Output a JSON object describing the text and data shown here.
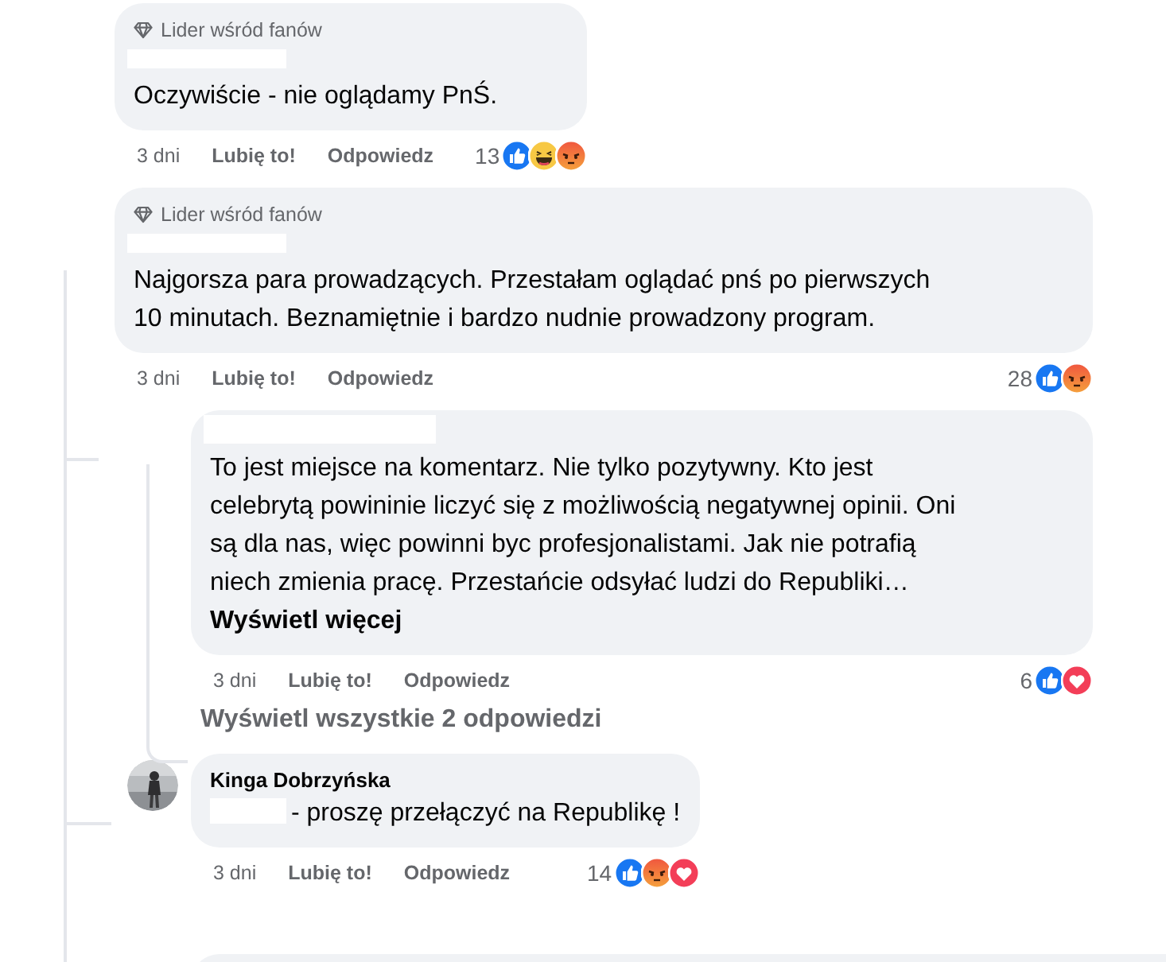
{
  "comments": [
    {
      "kind": "top",
      "badge": "Lider wśród fanów",
      "name_redacted": true,
      "text": "Oczywiście - nie oglądamy PnŚ.",
      "time": "3 dni",
      "like": "Lubię to!",
      "reply": "Odpowiedz",
      "count": "13",
      "reactions": [
        {
          "kind": "like"
        },
        {
          "kind": "haha"
        },
        {
          "kind": "angry"
        }
      ]
    },
    {
      "kind": "top",
      "badge": "Lider wśród fanów",
      "name_redacted": true,
      "text": "Najgorsza para prowadzących. Przestałam oglądać pnś po pierwszych 10 minutach. Beznamiętnie i bardzo nudnie prowadzony program.",
      "time": "3 dni",
      "like": "Lubię to!",
      "reply": "Odpowiedz",
      "count": "28",
      "reactions": [
        {
          "kind": "like"
        },
        {
          "kind": "angry"
        }
      ]
    },
    {
      "kind": "reply",
      "name_redacted": true,
      "text": "To jest miejsce na komentarz. Nie tylko pozytywny. Kto jest celebrytą powininie liczyć się z możliwością negatywnej opinii. Oni są dla nas, więc powinni byc profesjonalistami. Jak nie potrafią niech zmienia pracę. Przestańcie odsyłać ludzi do Republiki…",
      "more": "Wyświetl więcej",
      "time": "3 dni",
      "like": "Lubię to!",
      "reply": "Odpowiedz",
      "count": "6",
      "reactions": [
        {
          "kind": "like"
        },
        {
          "kind": "love"
        }
      ]
    },
    {
      "kind": "view_all",
      "text": "Wyświetl wszystkie 2 odpowiedzi"
    },
    {
      "kind": "reply",
      "author": "Kinga Dobrzyńska",
      "text_prefix_redacted": true,
      "text": "- proszę przełączyć na Republikę !",
      "time": "3 dni",
      "like": "Lubię to!",
      "reply": "Odpowiedz",
      "count": "14",
      "reactions": [
        {
          "kind": "like"
        },
        {
          "kind": "angry"
        },
        {
          "kind": "love"
        }
      ]
    }
  ]
}
